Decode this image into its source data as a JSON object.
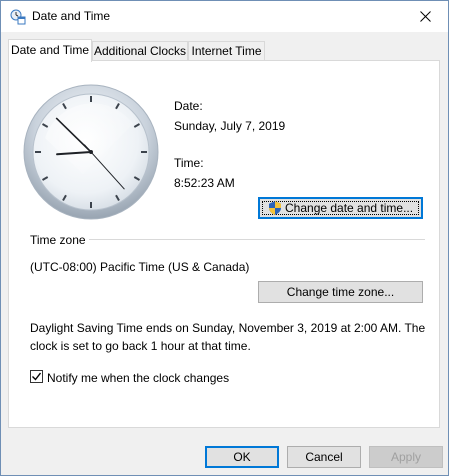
{
  "window": {
    "title": "Date and Time",
    "icon": "date-time-icon",
    "close_icon": "close-icon"
  },
  "tabs": [
    {
      "label": "Date and Time",
      "active": true
    },
    {
      "label": "Additional Clocks",
      "active": false
    },
    {
      "label": "Internet Time",
      "active": false
    }
  ],
  "clock": {
    "hour": 8,
    "minute": 52,
    "second": 23
  },
  "date": {
    "label": "Date:",
    "value": "Sunday, July 7, 2019"
  },
  "time": {
    "label": "Time:",
    "value": "8:52:23 AM"
  },
  "buttons": {
    "change_date_time": "Change date and time...",
    "change_time_zone": "Change time zone...",
    "ok": "OK",
    "cancel": "Cancel",
    "apply": "Apply"
  },
  "timezone": {
    "heading": "Time zone",
    "value": "(UTC-08:00) Pacific Time (US & Canada)"
  },
  "dst": {
    "line1": "Daylight Saving Time ends on Sunday, November 3, 2019 at 2:00 AM. The",
    "line2": "clock is set to go back 1 hour at that time."
  },
  "notify": {
    "label": "Notify me when the clock changes",
    "checked": true
  }
}
